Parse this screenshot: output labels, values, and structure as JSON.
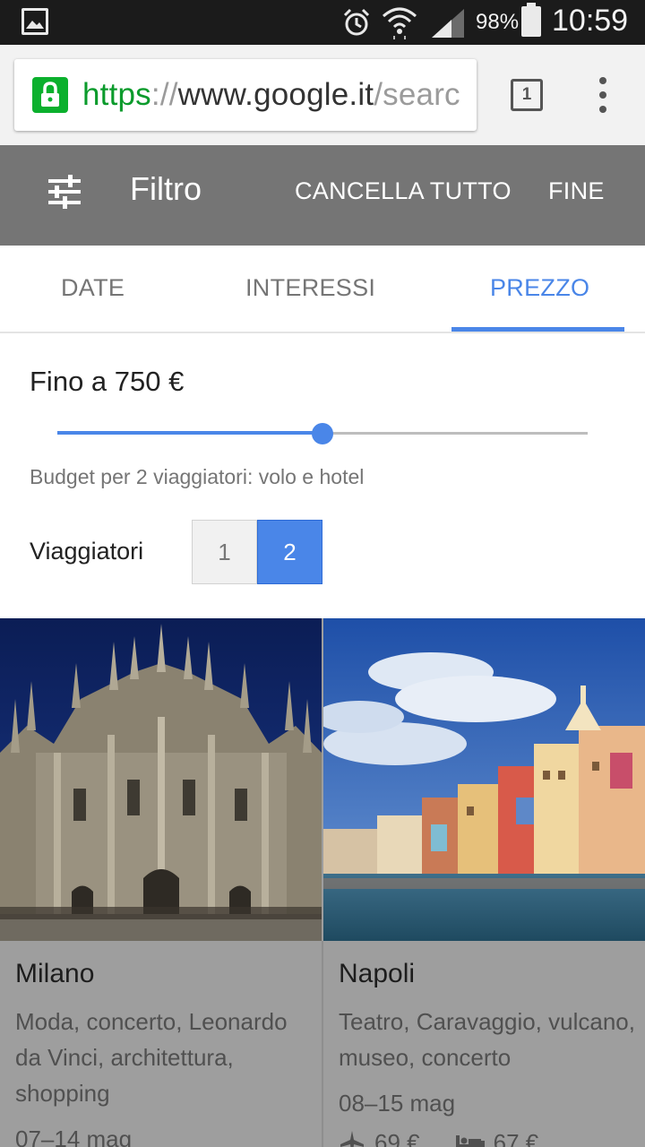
{
  "status_bar": {
    "battery_pct": "98%",
    "time": "10:59",
    "icons": [
      "gallery-icon",
      "alarm-icon",
      "wifi-icon",
      "signal-icon",
      "battery-icon"
    ]
  },
  "browser": {
    "url_scheme": "https",
    "url_sep": "://",
    "url_host": "www.google.it",
    "url_path": "/searc",
    "tab_count": "1"
  },
  "filter_header": {
    "title": "Filtro",
    "clear_label": "CANCELLA TUTTO",
    "done_label": "FINE"
  },
  "tabs": [
    {
      "label": "DATE",
      "active": false
    },
    {
      "label": "INTERESSI",
      "active": false
    },
    {
      "label": "PREZZO",
      "active": true
    }
  ],
  "price": {
    "label": "Fino a 750 €",
    "slider_fraction": 0.5,
    "budget_note": "Budget per 2 viaggiatori: volo e hotel"
  },
  "travelers": {
    "label": "Viaggiatori",
    "options": [
      "1",
      "2"
    ],
    "selected": "2"
  },
  "destinations": [
    {
      "name": "Milano",
      "tags": "Moda, concerto, Leonardo da Vinci, architettura, shopping",
      "dates": "07–14 mag"
    },
    {
      "name": "Napoli",
      "tags": "Teatro, Caravaggio, vulcano, museo, concerto",
      "dates": "08–15 mag",
      "flight_price": "69 €",
      "hotel_price": "67 €"
    }
  ],
  "colors": {
    "accent": "#4a86e8",
    "header": "#757575",
    "lock_green": "#0bb02d",
    "card_overlay": "#9e9e9e"
  }
}
